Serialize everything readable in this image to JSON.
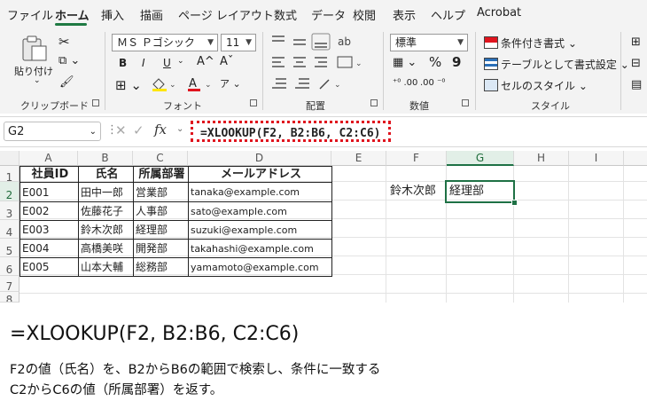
{
  "menu": [
    "ファイル",
    "ホーム",
    "挿入",
    "描画",
    "ページ レイアウト",
    "数式",
    "データ",
    "校閲",
    "表示",
    "ヘルプ",
    "Acrobat"
  ],
  "ribbon": {
    "clipboard": {
      "paste": "貼り付け",
      "label": "クリップボード"
    },
    "font": {
      "name": "ＭＳ Ｐゴシック",
      "size": "11",
      "bold": "B",
      "italic": "I",
      "underline": "U",
      "grow": "A^",
      "shrink": "Aˇ",
      "label": "フォント"
    },
    "alignment": {
      "label": "配置"
    },
    "number": {
      "format": "標準",
      "percent": "%",
      "comma": "9",
      "label": "数値"
    },
    "styles": {
      "conditional": "条件付き書式 ⌄",
      "table": "テーブルとして書式設定 ⌄",
      "cell": "セルのスタイル ⌄",
      "label": "スタイル"
    }
  },
  "formula_bar": {
    "name_box": "G2",
    "fx": "fx",
    "formula": "=XLOOKUP(F2, B2:B6, C2:C6)"
  },
  "columns": [
    "A",
    "B",
    "C",
    "D",
    "E",
    "F",
    "G",
    "H",
    "I"
  ],
  "rows": [
    "1",
    "2",
    "3",
    "4",
    "5",
    "6",
    "7",
    "8"
  ],
  "table": {
    "headers": [
      "社員ID",
      "氏名",
      "所属部署",
      "メールアドレス"
    ],
    "rows": [
      [
        "E001",
        "田中一郎",
        "営業部",
        "tanaka@example.com"
      ],
      [
        "E002",
        "佐藤花子",
        "人事部",
        "sato@example.com"
      ],
      [
        "E003",
        "鈴木次郎",
        "経理部",
        "suzuki@example.com"
      ],
      [
        "E004",
        "高橋美咲",
        "開発部",
        "takahashi@example.com"
      ],
      [
        "E005",
        "山本大輔",
        "総務部",
        "yamamoto@example.com"
      ]
    ]
  },
  "lookup": {
    "f2": "鈴木次郎",
    "g2": "経理部"
  },
  "explanation": {
    "formula": "=XLOOKUP(F2, B2:B6, C2:C6)",
    "line1": "F2の値（氏名）を、B2からB6の範囲で検索し、条件に一致する",
    "line2": "C2からC6の値（所属部署）を返す。"
  },
  "colors": {
    "accent": "#1e7145",
    "highlight": "#e0141e"
  }
}
